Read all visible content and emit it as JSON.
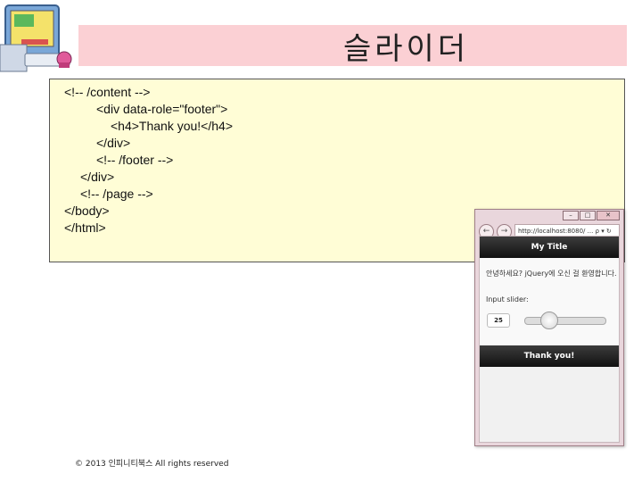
{
  "slide": {
    "title": "슬라이더",
    "code_lines": [
      "<!-- /content -->",
      "<div data-role=\"footer\">",
      "<h4>Thank you!</h4>",
      "</div>",
      "<!-- /footer -->",
      "</div>",
      "<!-- /page -->",
      "</body>",
      "</html>"
    ],
    "copyright": "© 2013 인피니티북스 All rights reserved"
  },
  "browser": {
    "controls": {
      "minimize": "–",
      "maximize": "□",
      "close": "✕"
    },
    "nav": {
      "back": "←",
      "forward": "→"
    },
    "address": "http://localhost:8080/ ... ρ ▾ ↻",
    "page": {
      "header_title": "My Title",
      "message": "안녕하세요? jQuery에 오신 걸 환영합니다.",
      "slider_label": "Input slider:",
      "slider_value": "25",
      "slider_fraction": 0.25,
      "footer_text": "Thank you!"
    }
  }
}
